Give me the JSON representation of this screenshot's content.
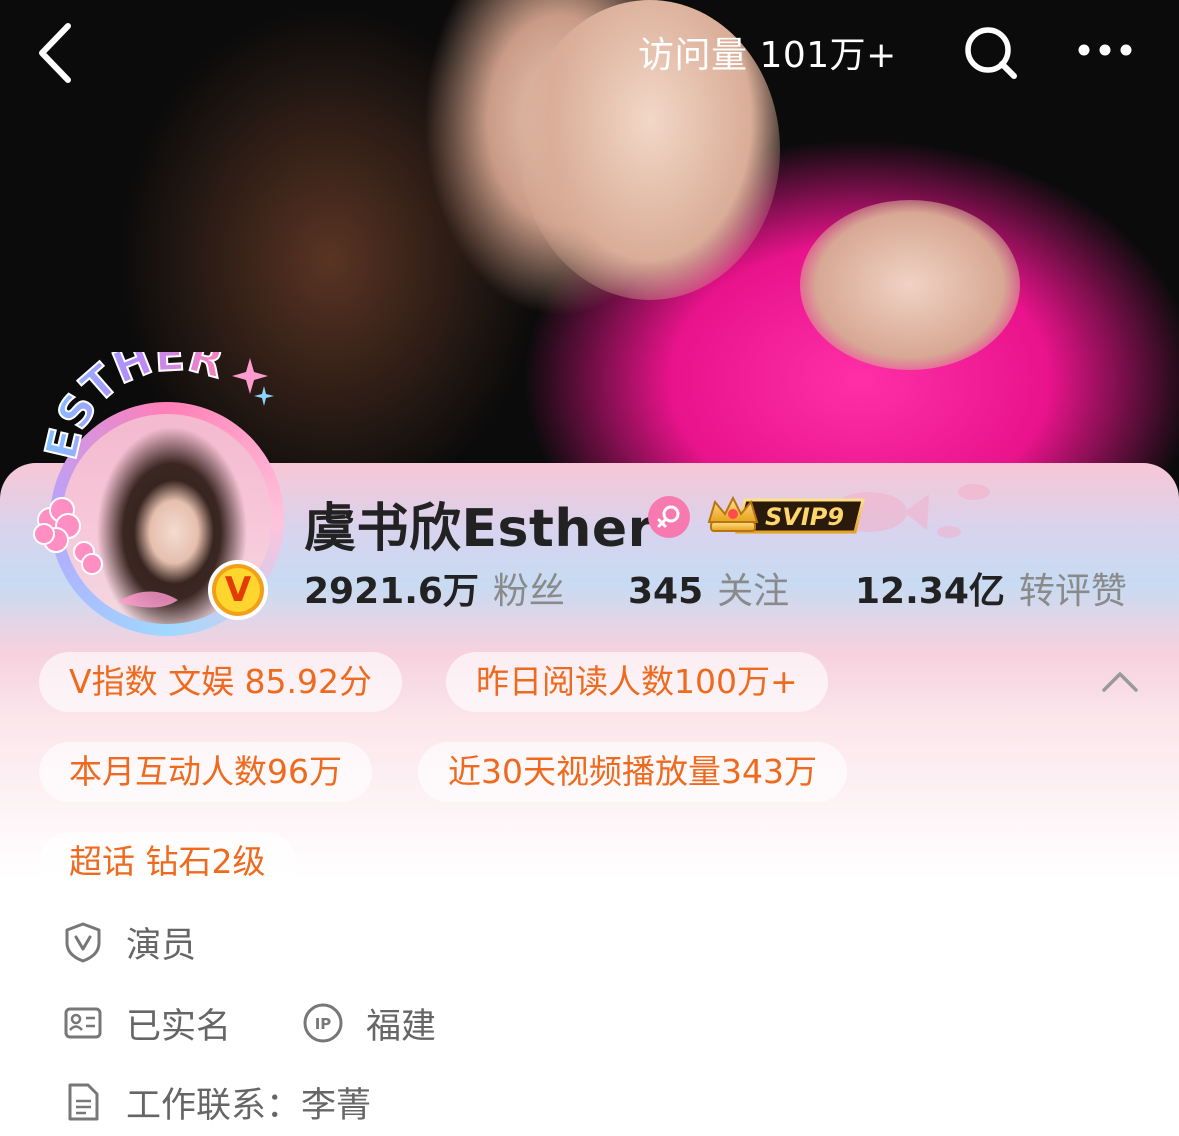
{
  "topbar": {
    "visits_text": "访问量 101万+",
    "back_icon": "chevron-left-icon",
    "search_icon": "search-icon",
    "more_icon": "more-dots-icon"
  },
  "profile": {
    "avatar_frame_text": "ESTHER",
    "verified_badge": "V",
    "name": "虞书欣Esther",
    "gender_icon": "female-icon",
    "vip_badge": "SVIP9"
  },
  "stats": [
    {
      "value": "2921.6万",
      "label": "粉丝"
    },
    {
      "value": "345",
      "label": "关注"
    },
    {
      "value": "12.34亿",
      "label": "转评赞"
    }
  ],
  "chips": [
    "V指数 文娱 85.92分",
    "昨日阅读人数100万+",
    "本月互动人数96万",
    "近30天视频播放量343万",
    "超话 钻石2级"
  ],
  "info": {
    "occupation": "演员",
    "verified_name": "已实名",
    "ip_label": "IP",
    "ip_location": "福建",
    "work_contact": "工作联系：李菁"
  },
  "colors": {
    "accent_orange": "#ee6a1e",
    "gender_pink": "#f67ab0",
    "text_dark": "#222222",
    "text_gray": "#8a8a8a"
  }
}
